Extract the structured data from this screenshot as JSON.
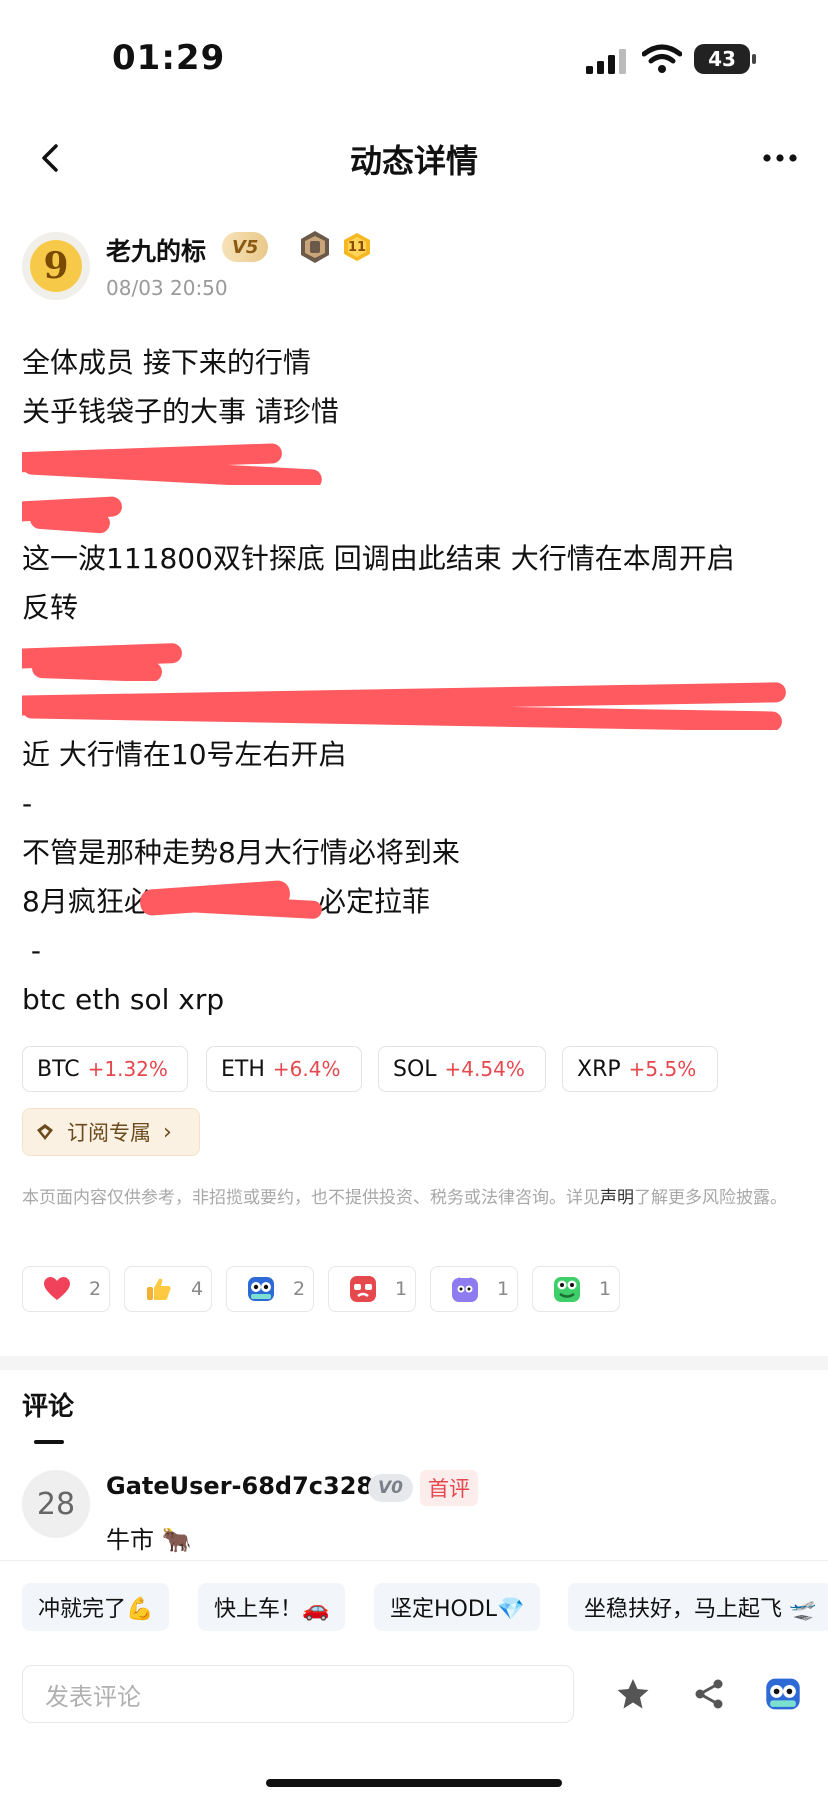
{
  "status_bar": {
    "time": "01:29",
    "battery": "43"
  },
  "nav": {
    "title": "动态详情"
  },
  "author": {
    "avatar_char": "9",
    "name": "老九的标",
    "vip_badge": "V5",
    "level_badge": "11",
    "timestamp": "08/03 20:50"
  },
  "post": {
    "lines": [
      "全体成员 接下来的行情",
      "关乎钱袋子的大事 请珍惜",
      "",
      "",
      "这一波111800双针探底 回调由此结束 大行情在本周开启",
      "反转",
      "",
      "",
      "近 大行情在10号左右开启",
      "-",
      "不管是那种走势8月大行情必将到来",
      "8月疯狂必",
      "必定拉菲",
      " -",
      "btc eth sol xrp"
    ]
  },
  "coins": [
    {
      "symbol": "BTC",
      "change": "+1.32%"
    },
    {
      "symbol": "ETH",
      "change": "+6.4%"
    },
    {
      "symbol": "SOL",
      "change": "+4.54%"
    },
    {
      "symbol": "XRP",
      "change": "+5.5%"
    }
  ],
  "subscribe": {
    "label": "订阅专属",
    "chevron": "›"
  },
  "disclaimer": {
    "before": "本页面内容仅供参考，非招揽或要约，也不提供投资、税务或法律咨询。详见",
    "link": "声明",
    "after": "了解更多风险披露。"
  },
  "reactions": [
    {
      "icon": "heart-icon",
      "count": "2"
    },
    {
      "icon": "thumbs-up-icon",
      "count": "4"
    },
    {
      "icon": "hodl-owl-icon",
      "count": "2"
    },
    {
      "icon": "angry-face-icon",
      "count": "1"
    },
    {
      "icon": "purple-cat-icon",
      "count": "1"
    },
    {
      "icon": "green-frog-icon",
      "count": "1"
    }
  ],
  "comments": {
    "title": "评论",
    "items": [
      {
        "avatar_text": "28",
        "user": "GateUser-68d7c328",
        "vip": "V0",
        "tag": "首评",
        "text": "牛市 🐂"
      }
    ]
  },
  "quick_replies": [
    "冲就完了💪",
    "快上车！🚗",
    "坚定HODL💎",
    "坐稳扶好，马上起飞 🛫"
  ],
  "composer": {
    "placeholder": "发表评论"
  },
  "colors": {
    "up": "#e5484d",
    "scribble": "#ff5a5f",
    "accent_bg": "#fbf1e2"
  }
}
